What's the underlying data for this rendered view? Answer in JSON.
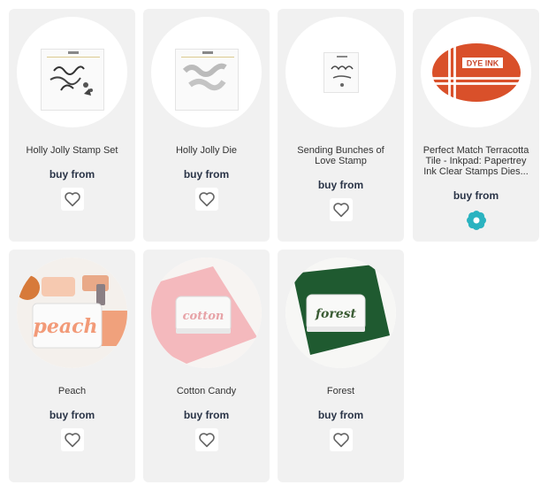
{
  "buy_label": "buy from",
  "products": [
    {
      "title": "Holly Jolly Stamp Set",
      "favorite_icon": "heart-outline-icon"
    },
    {
      "title": "Holly Jolly Die",
      "favorite_icon": "heart-outline-icon"
    },
    {
      "title": "Sending Bunches of Love Stamp",
      "favorite_icon": "heart-outline-icon"
    },
    {
      "title": "Perfect Match Terracotta Tile - Inkpad: Papertrey Ink Clear Stamps Dies...",
      "favorite_icon": "flower-icon",
      "image_text": "DYE INK"
    },
    {
      "title": "Peach",
      "favorite_icon": "heart-outline-icon",
      "image_text": "peach"
    },
    {
      "title": "Cotton Candy",
      "favorite_icon": "heart-outline-icon",
      "image_text": "cotton"
    },
    {
      "title": "Forest",
      "favorite_icon": "heart-outline-icon",
      "image_text": "forest"
    }
  ],
  "colors": {
    "card_bg": "#f1f1f1",
    "buy_text": "#2a3447",
    "terracotta": "#d9502a",
    "forest": "#1f5a30",
    "cotton_candy": "#f4b9bd",
    "peach": "#f0a17c",
    "flower_teal": "#2bb3c0"
  }
}
